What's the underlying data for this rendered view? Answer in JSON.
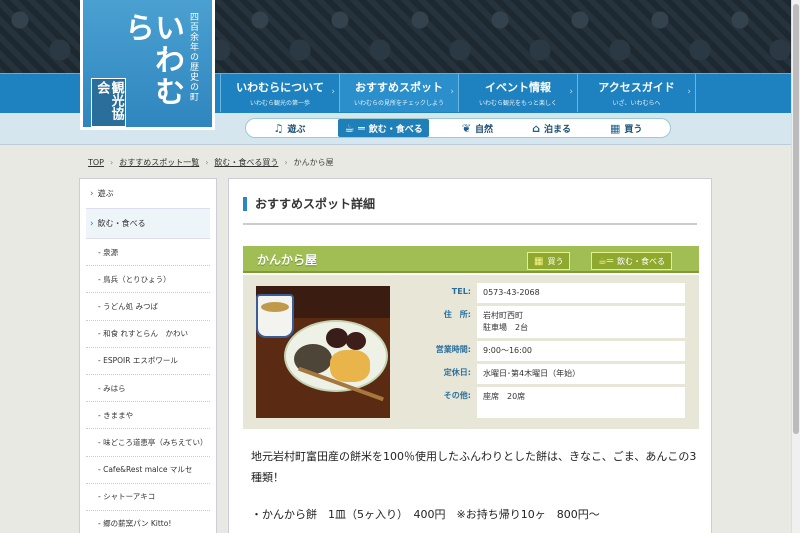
{
  "logo": {
    "main": "いわむら",
    "side": "四百余年の歴史の町",
    "stamp": "観光協会"
  },
  "main_nav": [
    {
      "title": "いわむらについて",
      "sub": "いわむら観光の第一歩"
    },
    {
      "title": "おすすめスポット",
      "sub": "いわむらの見所をチェックしよう"
    },
    {
      "title": "イベント情報",
      "sub": "いわむら観光をもっと楽しく"
    },
    {
      "title": "アクセスガイド",
      "sub": "いざ、いわむらへ"
    }
  ],
  "sub_nav": [
    {
      "label": "遊ぶ",
      "icon": "music-note-icon"
    },
    {
      "label": "飲む・食べる",
      "icon": "cup-chopsticks-icon"
    },
    {
      "label": "自然",
      "icon": "leaf-icon"
    },
    {
      "label": "泊まる",
      "icon": "house-icon"
    },
    {
      "label": "買う",
      "icon": "gift-icon"
    }
  ],
  "breadcrumb": [
    "TOP",
    "おすすめスポット一覧",
    "飲む・食べる買う",
    "かんから屋"
  ],
  "sidebar": {
    "cats": [
      "遊ぶ",
      "飲む・食べる"
    ],
    "items": [
      "- 泉源",
      "- 鳥兵（とりひょう）",
      "- うどん処 みつば",
      "- 和食 れすとらん　かわい",
      "- ESPOIR エスポワール",
      "- みはら",
      "- きままや",
      "- 味どころ道恵亭（みちえてい）",
      "- Cafe&Rest malce マルセ",
      "- シャトーアキコ",
      "- 郷の薪窯パン Kitto!"
    ]
  },
  "section_title": "おすすめスポット詳細",
  "spot": {
    "name": "かんから屋",
    "tags": [
      "買う",
      "飲む・食べる"
    ],
    "info": {
      "tel_label": "TEL:",
      "tel": "0573-43-2068",
      "addr_label": "住　所:",
      "addr1": "岩村町西町",
      "addr2": "駐車場　2台",
      "hours_label": "営業時間:",
      "hours": "9:00～16:00",
      "closed_label": "定休日:",
      "closed": "水曜日･第4木曜日（年始）",
      "other_label": "その他:",
      "other": "座席　20席"
    },
    "description": "地元岩村町富田産の餅米を100％使用したふんわりとした餅は、きなこ、ごま、あんこの3種類！",
    "price": "・かんから餅　1皿（5ヶ入り）　400円　※お持ち帰り10ヶ　800円～"
  },
  "colors": {
    "nav_blue": "#1e82c0",
    "spot_green": "#a1be55",
    "accent": "#2a86c4"
  }
}
